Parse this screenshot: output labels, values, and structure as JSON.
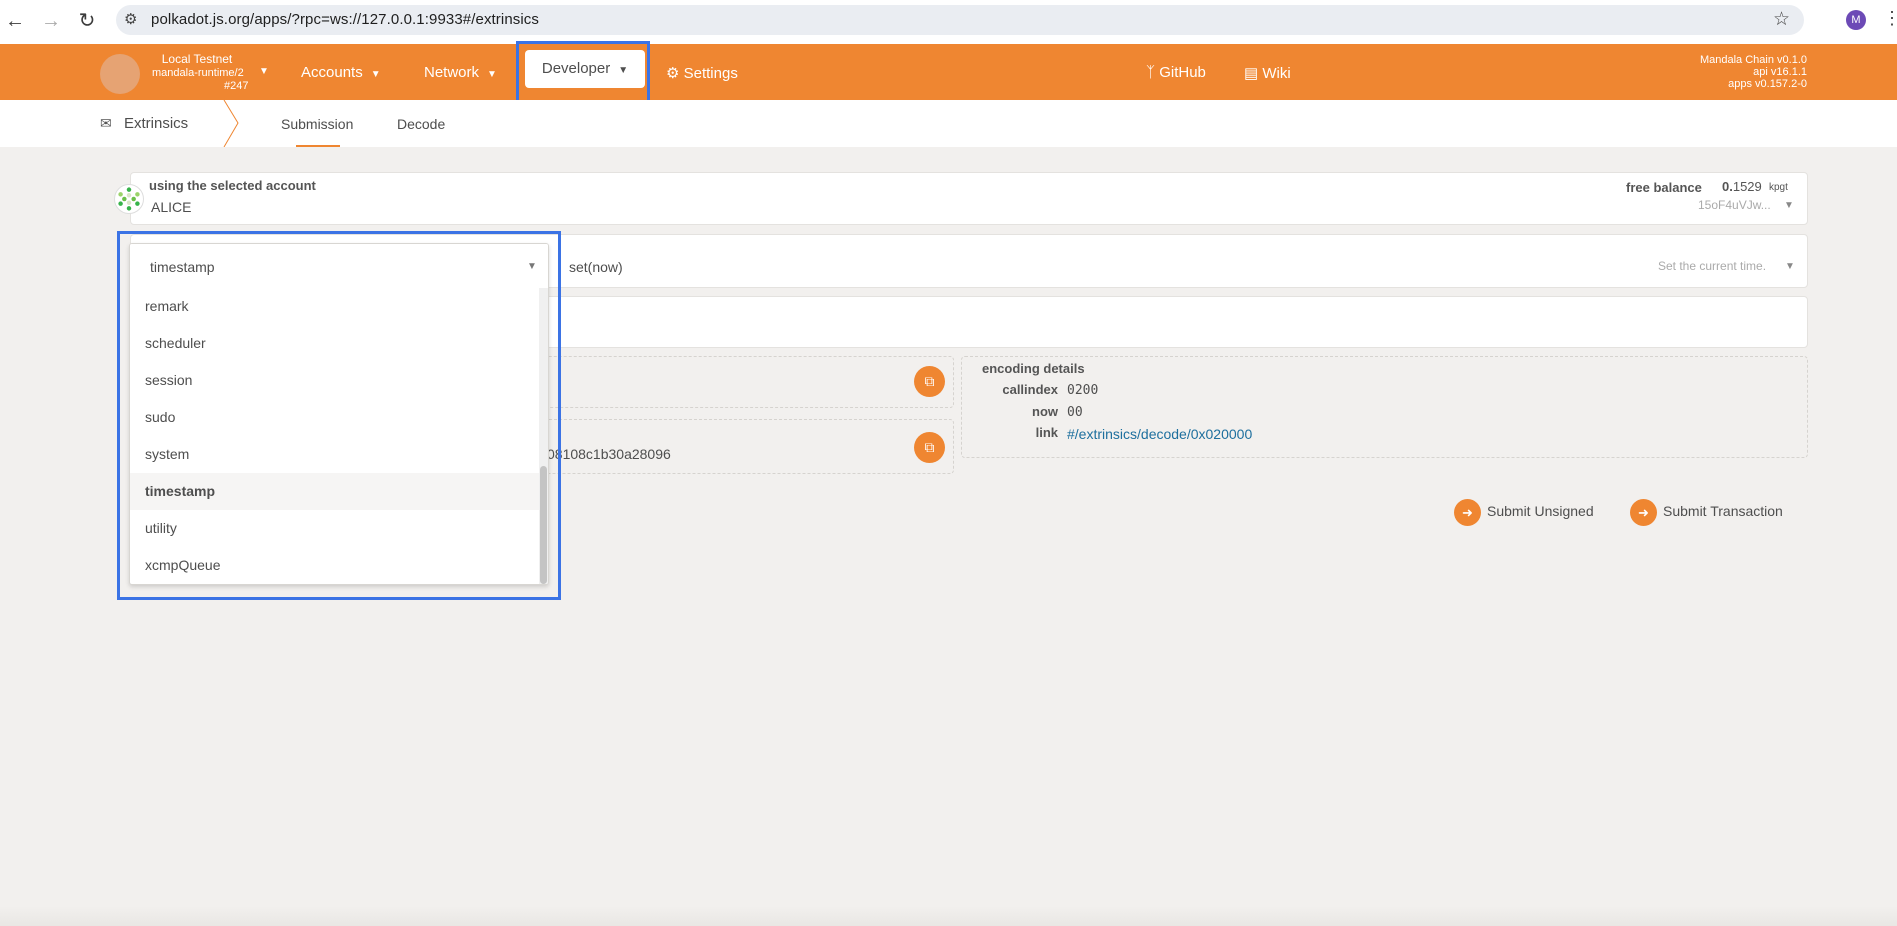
{
  "browser": {
    "url": "polkadot.js.org/apps/?rpc=ws://127.0.0.1:9933#/extrinsics",
    "profile_initial": "M"
  },
  "chain": {
    "name": "Local Testnet",
    "runtime": "mandala-runtime/2",
    "block": "#247"
  },
  "menu": {
    "accounts": "Accounts",
    "network": "Network",
    "developer": "Developer",
    "settings": "Settings",
    "github": "GitHub",
    "wiki": "Wiki"
  },
  "versions": {
    "chain": "Mandala Chain v0.1.0",
    "api": "api v16.1.1",
    "apps": "apps v0.157.2-0"
  },
  "tabs": {
    "section": "Extrinsics",
    "submission": "Submission",
    "decode": "Decode"
  },
  "account": {
    "label": "using the selected account",
    "name": "ALICE",
    "free_balance_label": "free balance",
    "free_balance_int": "0.",
    "free_balance_dec": "1529",
    "unit": "kpgt",
    "address": "15oF4uVJw..."
  },
  "call": {
    "method": "set(now)",
    "description": "Set the current time."
  },
  "hash": {
    "partial_value": "08108c1b30a28096"
  },
  "encoding": {
    "title": "encoding details",
    "callindex_label": "callindex",
    "callindex_value": "0200",
    "now_label": "now",
    "now_value": "00",
    "link_label": "link",
    "link_value": "#/extrinsics/decode/0x020000"
  },
  "actions": {
    "submit_unsigned": "Submit Unsigned",
    "submit_transaction": "Submit Transaction"
  },
  "dropdown": {
    "input_value": "timestamp",
    "options": [
      "remark",
      "scheduler",
      "session",
      "sudo",
      "system",
      "timestamp",
      "utility",
      "xcmpQueue"
    ],
    "selected": "timestamp"
  },
  "colors": {
    "brand": "#ef8631",
    "highlight": "#3b73e5",
    "link": "#1d6f9e"
  }
}
